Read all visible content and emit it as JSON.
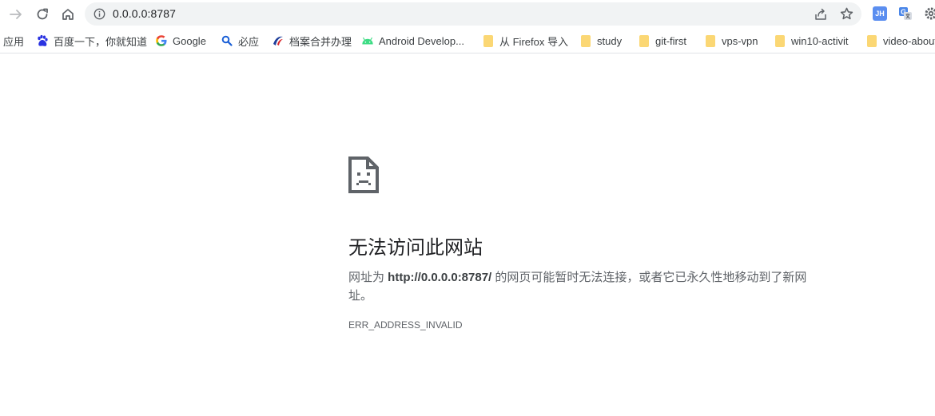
{
  "toolbar": {
    "url": "0.0.0.0:8787",
    "extensions": {
      "jh_label": "JH"
    }
  },
  "bookmarks": [
    {
      "label": "应用",
      "icon": "apps-icon"
    },
    {
      "label": "百度一下，你就知道",
      "icon": "baidu-icon"
    },
    {
      "label": "Google",
      "icon": "google-icon"
    },
    {
      "label": "必应",
      "icon": "bing-search-icon"
    },
    {
      "label": "档案合并办理",
      "icon": "archive-logo-icon"
    },
    {
      "label": "Android Develop...",
      "icon": "android-icon"
    },
    {
      "label": "从 Firefox 导入",
      "icon": "folder-icon"
    },
    {
      "label": "study",
      "icon": "folder-icon"
    },
    {
      "label": "git-first",
      "icon": "folder-icon"
    },
    {
      "label": "vps-vpn",
      "icon": "folder-icon"
    },
    {
      "label": "win10-activit",
      "icon": "folder-icon"
    },
    {
      "label": "video-about",
      "icon": "folder-icon"
    }
  ],
  "error": {
    "title": "无法访问此网站",
    "msg_prefix": "网址为 ",
    "msg_url": "http://0.0.0.0:8787/",
    "msg_suffix": " 的网页可能暂时无法连接，或者它已永久性地移动到了新网址。",
    "code": "ERR_ADDRESS_INVALID"
  },
  "colors": {
    "omnibox_bg": "#f1f3f4",
    "title_text": "#202124",
    "body_text": "#5f6368",
    "folder": "#fbd774",
    "extension_blue": "#5b8ef0"
  }
}
